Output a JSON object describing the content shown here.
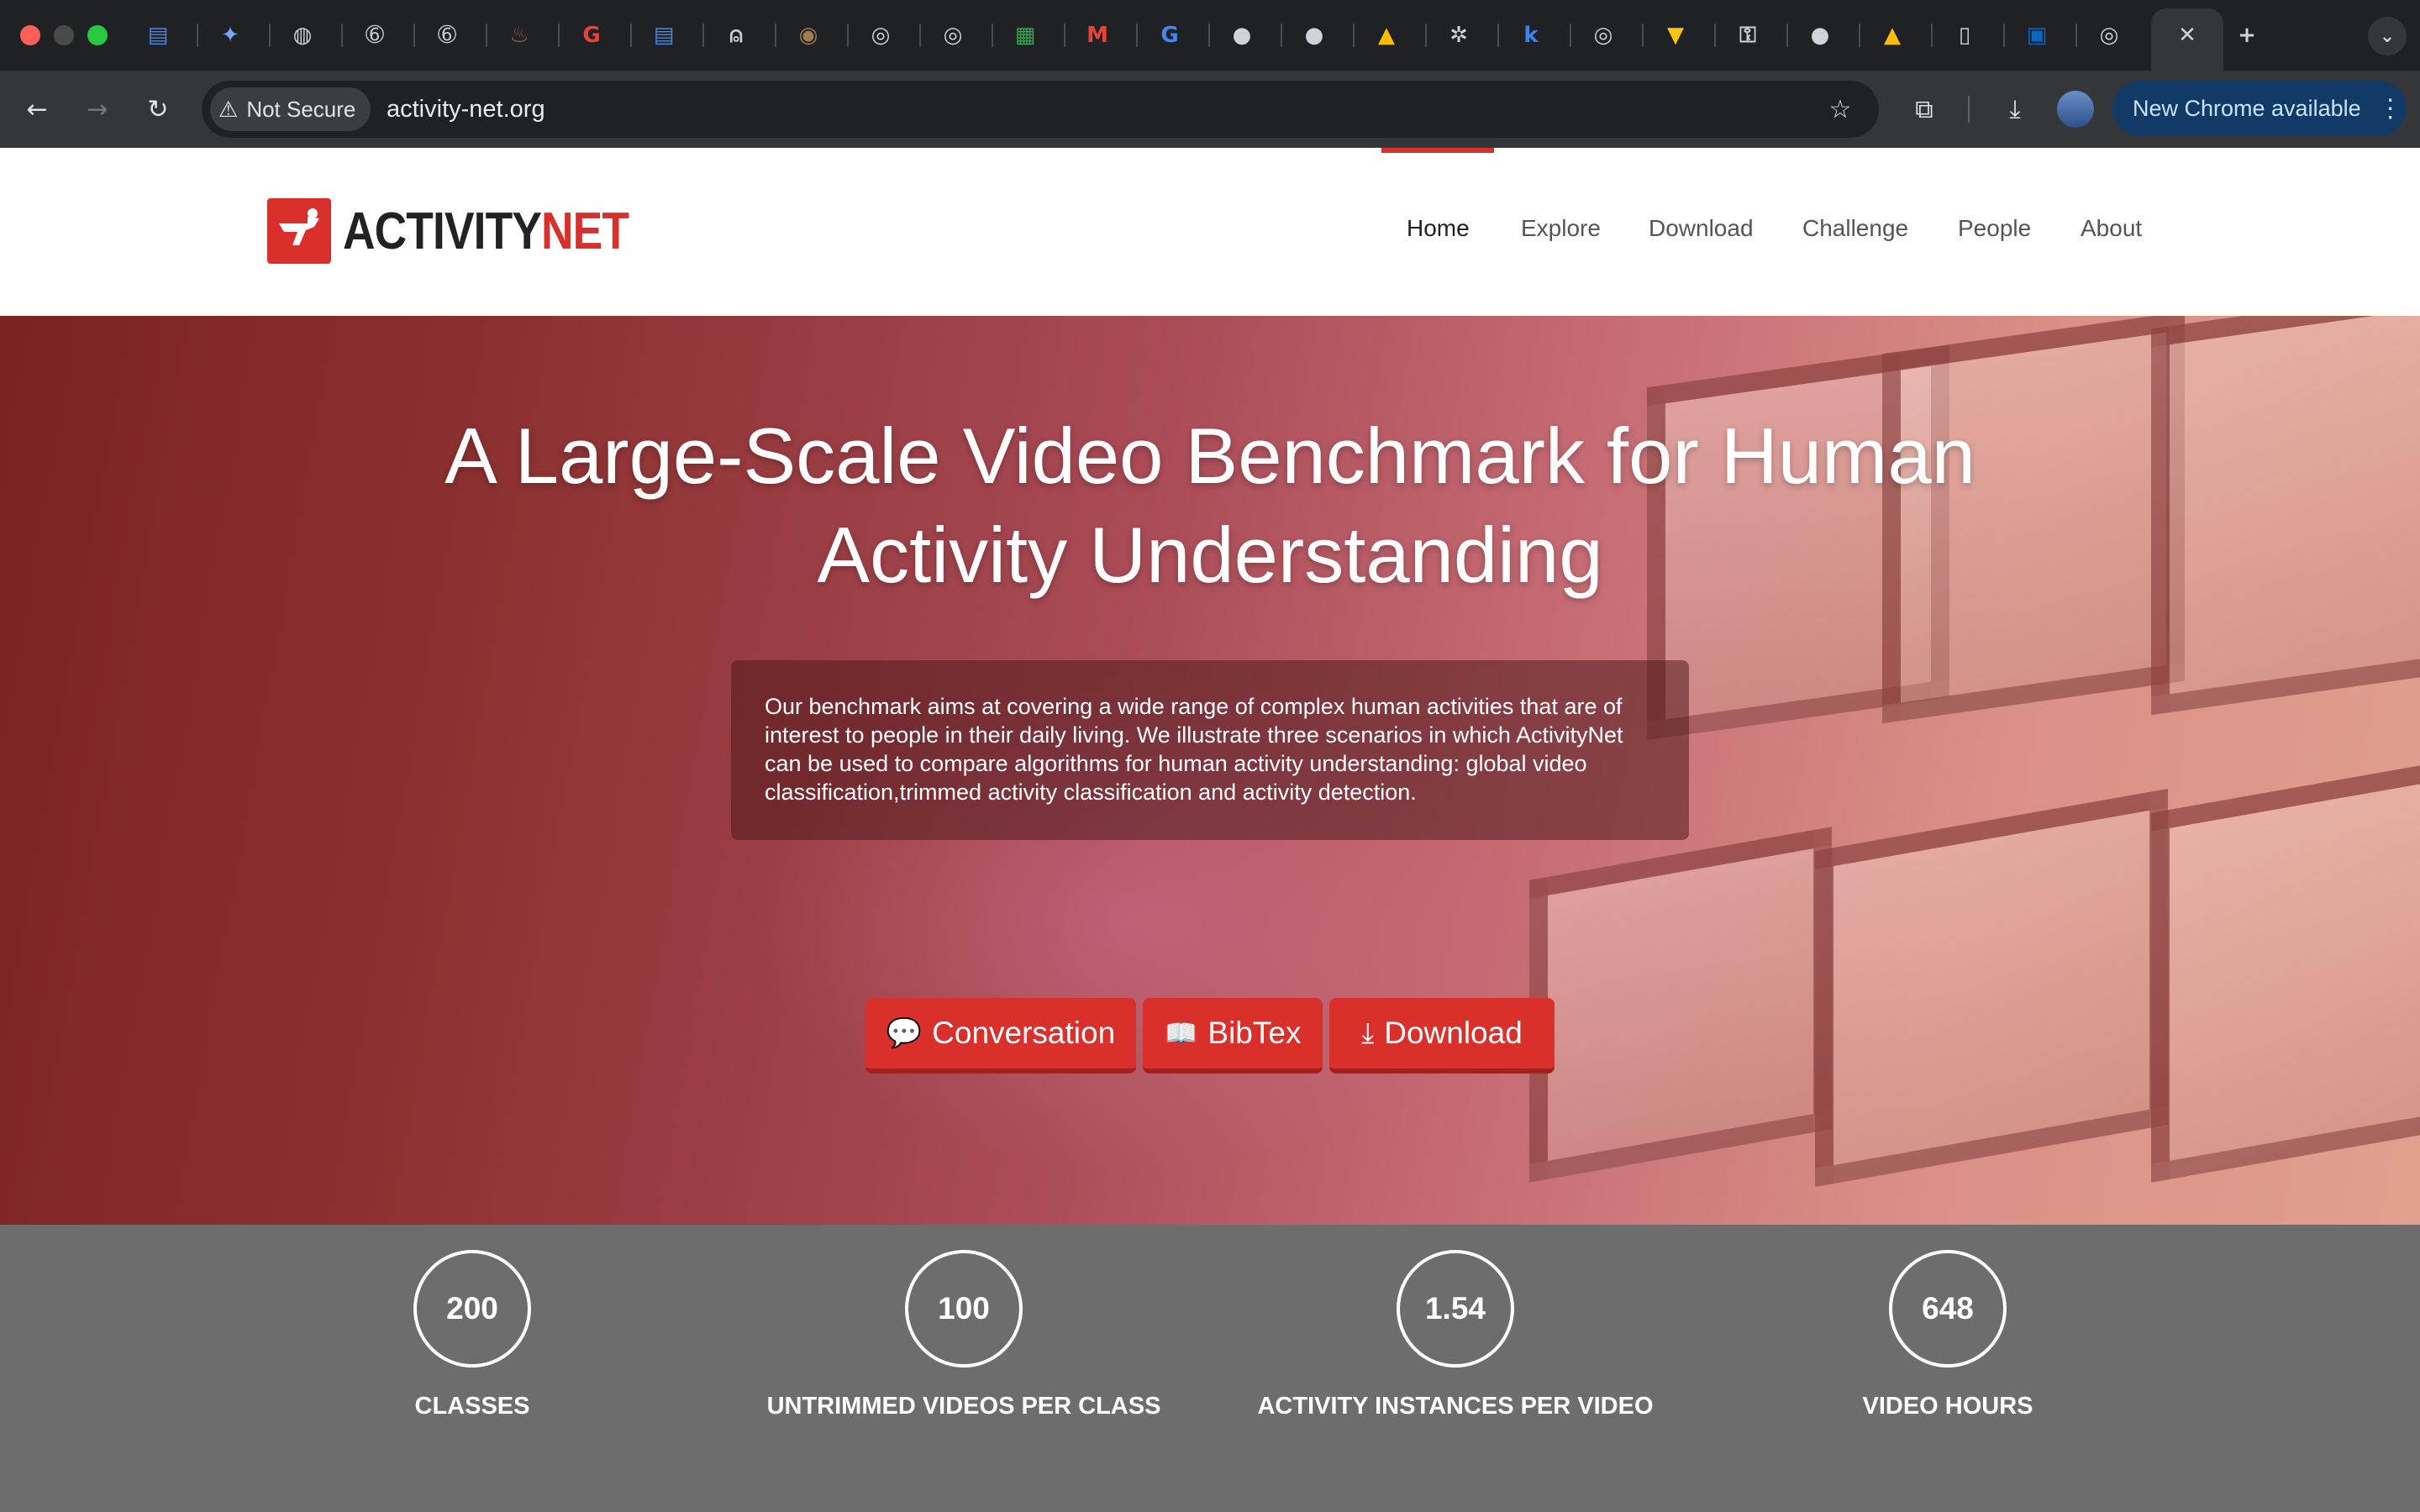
{
  "browser": {
    "omnibox": {
      "security_label": "Not Secure",
      "url": "activity-net.org"
    },
    "update_button_label": "New Chrome available",
    "new_tab_symbol": "+",
    "close_tab_symbol": "✕"
  },
  "site": {
    "logo": {
      "part1": "ACTIVITY",
      "part2": "NET"
    },
    "nav": [
      {
        "label": "Home",
        "active": true
      },
      {
        "label": "Explore"
      },
      {
        "label": "Download"
      },
      {
        "label": "Challenge"
      },
      {
        "label": "People"
      },
      {
        "label": "About"
      }
    ]
  },
  "hero": {
    "title": "A Large-Scale Video Benchmark for Human Activity Understanding",
    "description": "Our benchmark aims at covering a wide range of complex human activities that are of interest to people in their daily living. We illustrate three scenarios in which ActivityNet can be used to compare algorithms for human activity understanding: global video classification,trimmed activity classification and activity detection.",
    "buttons": [
      {
        "label": "Conversation",
        "icon": "comment-icon"
      },
      {
        "label": "BibTex",
        "icon": "book-icon"
      },
      {
        "label": "Download",
        "icon": "download-icon"
      }
    ]
  },
  "stats": [
    {
      "value": "200",
      "label": "CLASSES"
    },
    {
      "value": "100",
      "label": "UNTRIMMED VIDEOS PER CLASS"
    },
    {
      "value": "1.54",
      "label": "ACTIVITY INSTANCES PER VIDEO"
    },
    {
      "value": "648",
      "label": "VIDEO HOURS"
    }
  ],
  "colors": {
    "brand_red": "#d9302b",
    "stats_bg": "#6d6d6d",
    "chrome_dark": "#202124"
  }
}
